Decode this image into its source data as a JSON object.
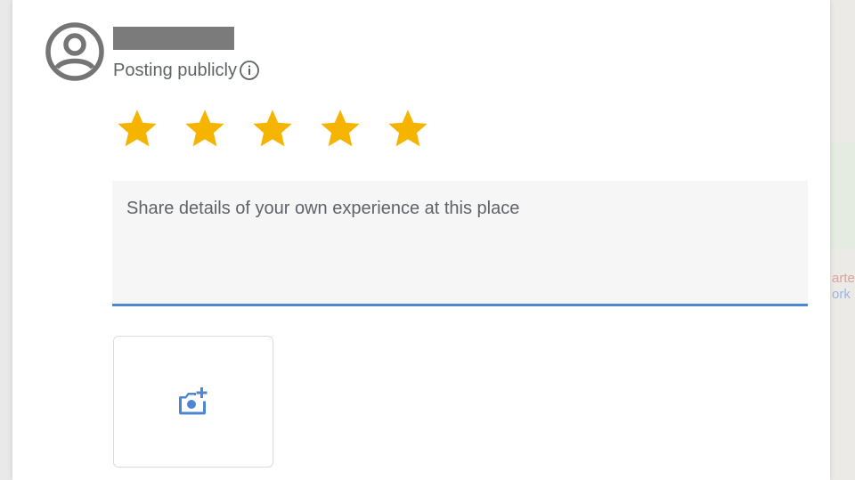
{
  "user": {
    "posting_label": "Posting publicly"
  },
  "rating": {
    "value": 5,
    "max": 5,
    "star_color": "#f4b400"
  },
  "review": {
    "placeholder": "Share details of your own experience at this place",
    "value": ""
  },
  "photo": {
    "icon": "add-photo-camera-icon",
    "icon_color": "#4f86d4"
  },
  "map_background": {
    "label_line_1": "arte",
    "label_line_2": "ork"
  },
  "colors": {
    "accent": "#4f86d4",
    "text_secondary": "#5f6368",
    "redacted_name": "#7b7b7b"
  }
}
